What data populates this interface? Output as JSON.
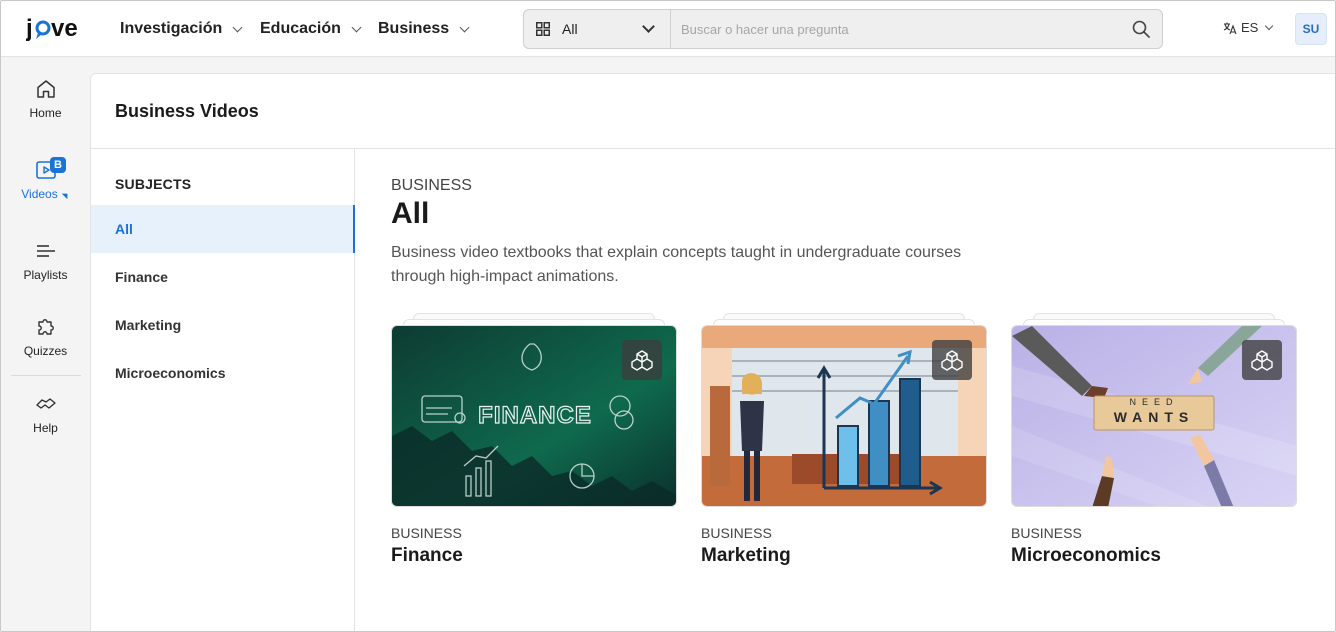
{
  "brand": {
    "logo_text": "jove"
  },
  "topnav": [
    {
      "label": "Investigación"
    },
    {
      "label": "Educación"
    },
    {
      "label": "Business"
    }
  ],
  "search": {
    "scope": "All",
    "placeholder": "Buscar o hacer una pregunta"
  },
  "language": {
    "code": "ES"
  },
  "user": {
    "initials": "SU"
  },
  "rail": {
    "home": "Home",
    "videos": "Videos",
    "videos_badge": "B",
    "playlists": "Playlists",
    "quizzes": "Quizzes",
    "help": "Help"
  },
  "page": {
    "title": "Business Videos"
  },
  "subjects": {
    "heading": "SUBJECTS",
    "items": [
      {
        "label": "All",
        "active": true
      },
      {
        "label": "Finance",
        "active": false
      },
      {
        "label": "Marketing",
        "active": false
      },
      {
        "label": "Microeconomics",
        "active": false
      }
    ]
  },
  "main": {
    "kicker": "BUSINESS",
    "heading": "All",
    "description": "Business video textbooks that explain concepts taught in undergraduate courses through high-impact animations."
  },
  "cards": [
    {
      "kicker": "BUSINESS",
      "title": "Finance",
      "thumb_text": "FINANCE",
      "thumb_icon": "finance-illustration"
    },
    {
      "kicker": "BUSINESS",
      "title": "Marketing",
      "thumb_icon": "marketing-illustration"
    },
    {
      "kicker": "BUSINESS",
      "title": "Microeconomics",
      "thumb_words": [
        "NEED",
        "WANTS"
      ],
      "thumb_icon": "microeconomics-illustration"
    }
  ],
  "colors": {
    "accent": "#1a73d9",
    "finance_bg": "#0e5a45",
    "marketing_bg": "#f3c9a6",
    "micro_bg": "#c9c2ee"
  }
}
